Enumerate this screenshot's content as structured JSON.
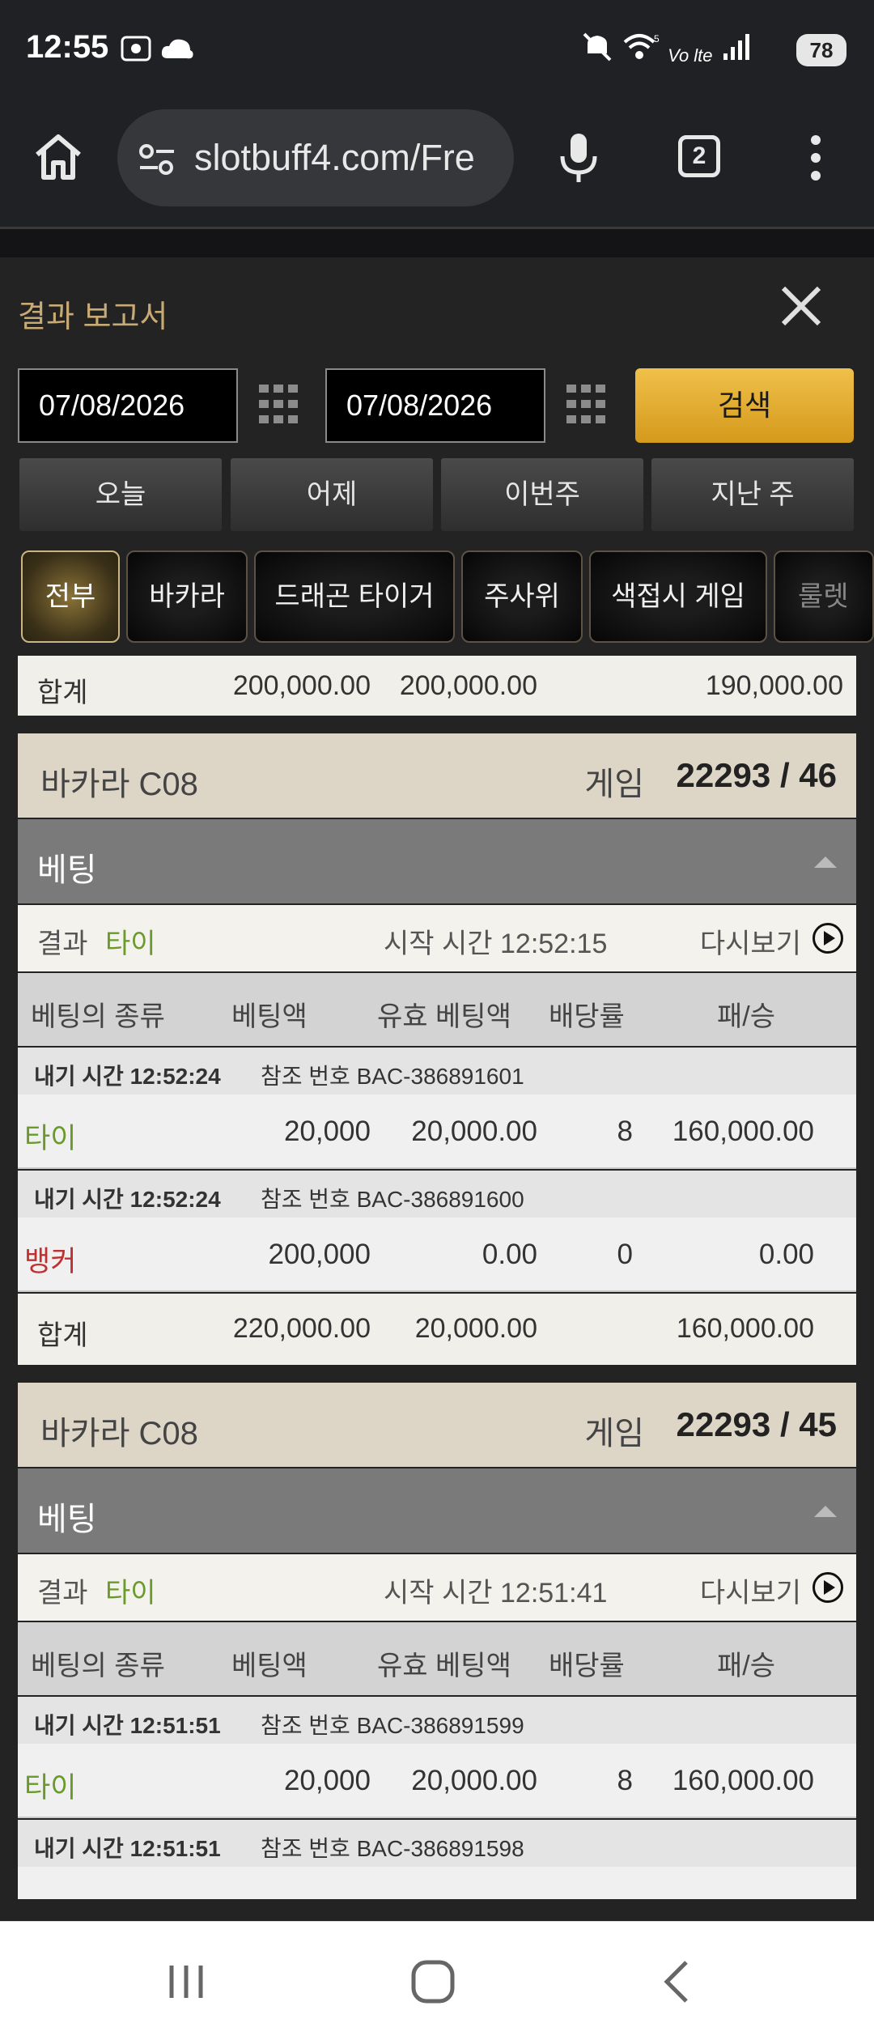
{
  "status_bar": {
    "time": "12:55",
    "left_icons": [
      "screenshot-icon",
      "cloud-icon"
    ],
    "right_icons": [
      "mute-icon",
      "wifi-icon",
      "volte-icon",
      "signal-icon"
    ],
    "volte_label": "Vo lte",
    "battery": "78"
  },
  "browser": {
    "url": "slotbuff4.com/Fre",
    "tab_count": "2"
  },
  "panel": {
    "title": "결과 보고서",
    "start_date": "07/08/2026",
    "end_date": "07/08/2026",
    "search_label": "검색",
    "ranges": [
      "오늘",
      "어제",
      "이번주",
      "지난 주"
    ],
    "categories": [
      "전부",
      "바카라",
      "드래곤 타이거",
      "주사위",
      "색접시 게임",
      "룰렛"
    ],
    "active_category": "전부"
  },
  "report": {
    "top_total": {
      "label": "합계",
      "bet": "200,000.00",
      "valid": "200,000.00",
      "payout": "190,000.00"
    },
    "games": [
      {
        "name": "바카라 C08",
        "game_label": "게임",
        "game_number": "22293 / 46",
        "betting_label": "베팅",
        "result_label": "결과",
        "result_value": "타이",
        "start_time": "시작 시간 12:52:15",
        "replay": "다시보기",
        "columns": [
          "베팅의 종류",
          "베팅액",
          "유효 베팅액",
          "배당률",
          "패/승"
        ],
        "bets": [
          {
            "time": "내기 시간 12:52:24",
            "ref": "참조 번호 BAC-386891601",
            "type": "타이",
            "amount": "20,000",
            "valid": "20,000.00",
            "odds": "8",
            "win": "160,000.00"
          },
          {
            "time": "내기 시간 12:52:24",
            "ref": "참조 번호 BAC-386891600",
            "type": "뱅커",
            "amount": "200,000",
            "valid": "0.00",
            "odds": "0",
            "win": "0.00"
          }
        ],
        "total": {
          "label": "합계",
          "bet": "220,000.00",
          "valid": "20,000.00",
          "payout": "160,000.00"
        }
      },
      {
        "name": "바카라 C08",
        "game_label": "게임",
        "game_number": "22293 / 45",
        "betting_label": "베팅",
        "result_label": "결과",
        "result_value": "타이",
        "start_time": "시작 시간 12:51:41",
        "replay": "다시보기",
        "columns": [
          "베팅의 종류",
          "베팅액",
          "유효 베팅액",
          "배당률",
          "패/승"
        ],
        "bets": [
          {
            "time": "내기 시간 12:51:51",
            "ref": "참조 번호 BAC-386891599",
            "type": "타이",
            "amount": "20,000",
            "valid": "20,000.00",
            "odds": "8",
            "win": "160,000.00"
          },
          {
            "time": "내기 시간 12:51:51",
            "ref": "참조 번호 BAC-386891598"
          }
        ]
      }
    ]
  }
}
